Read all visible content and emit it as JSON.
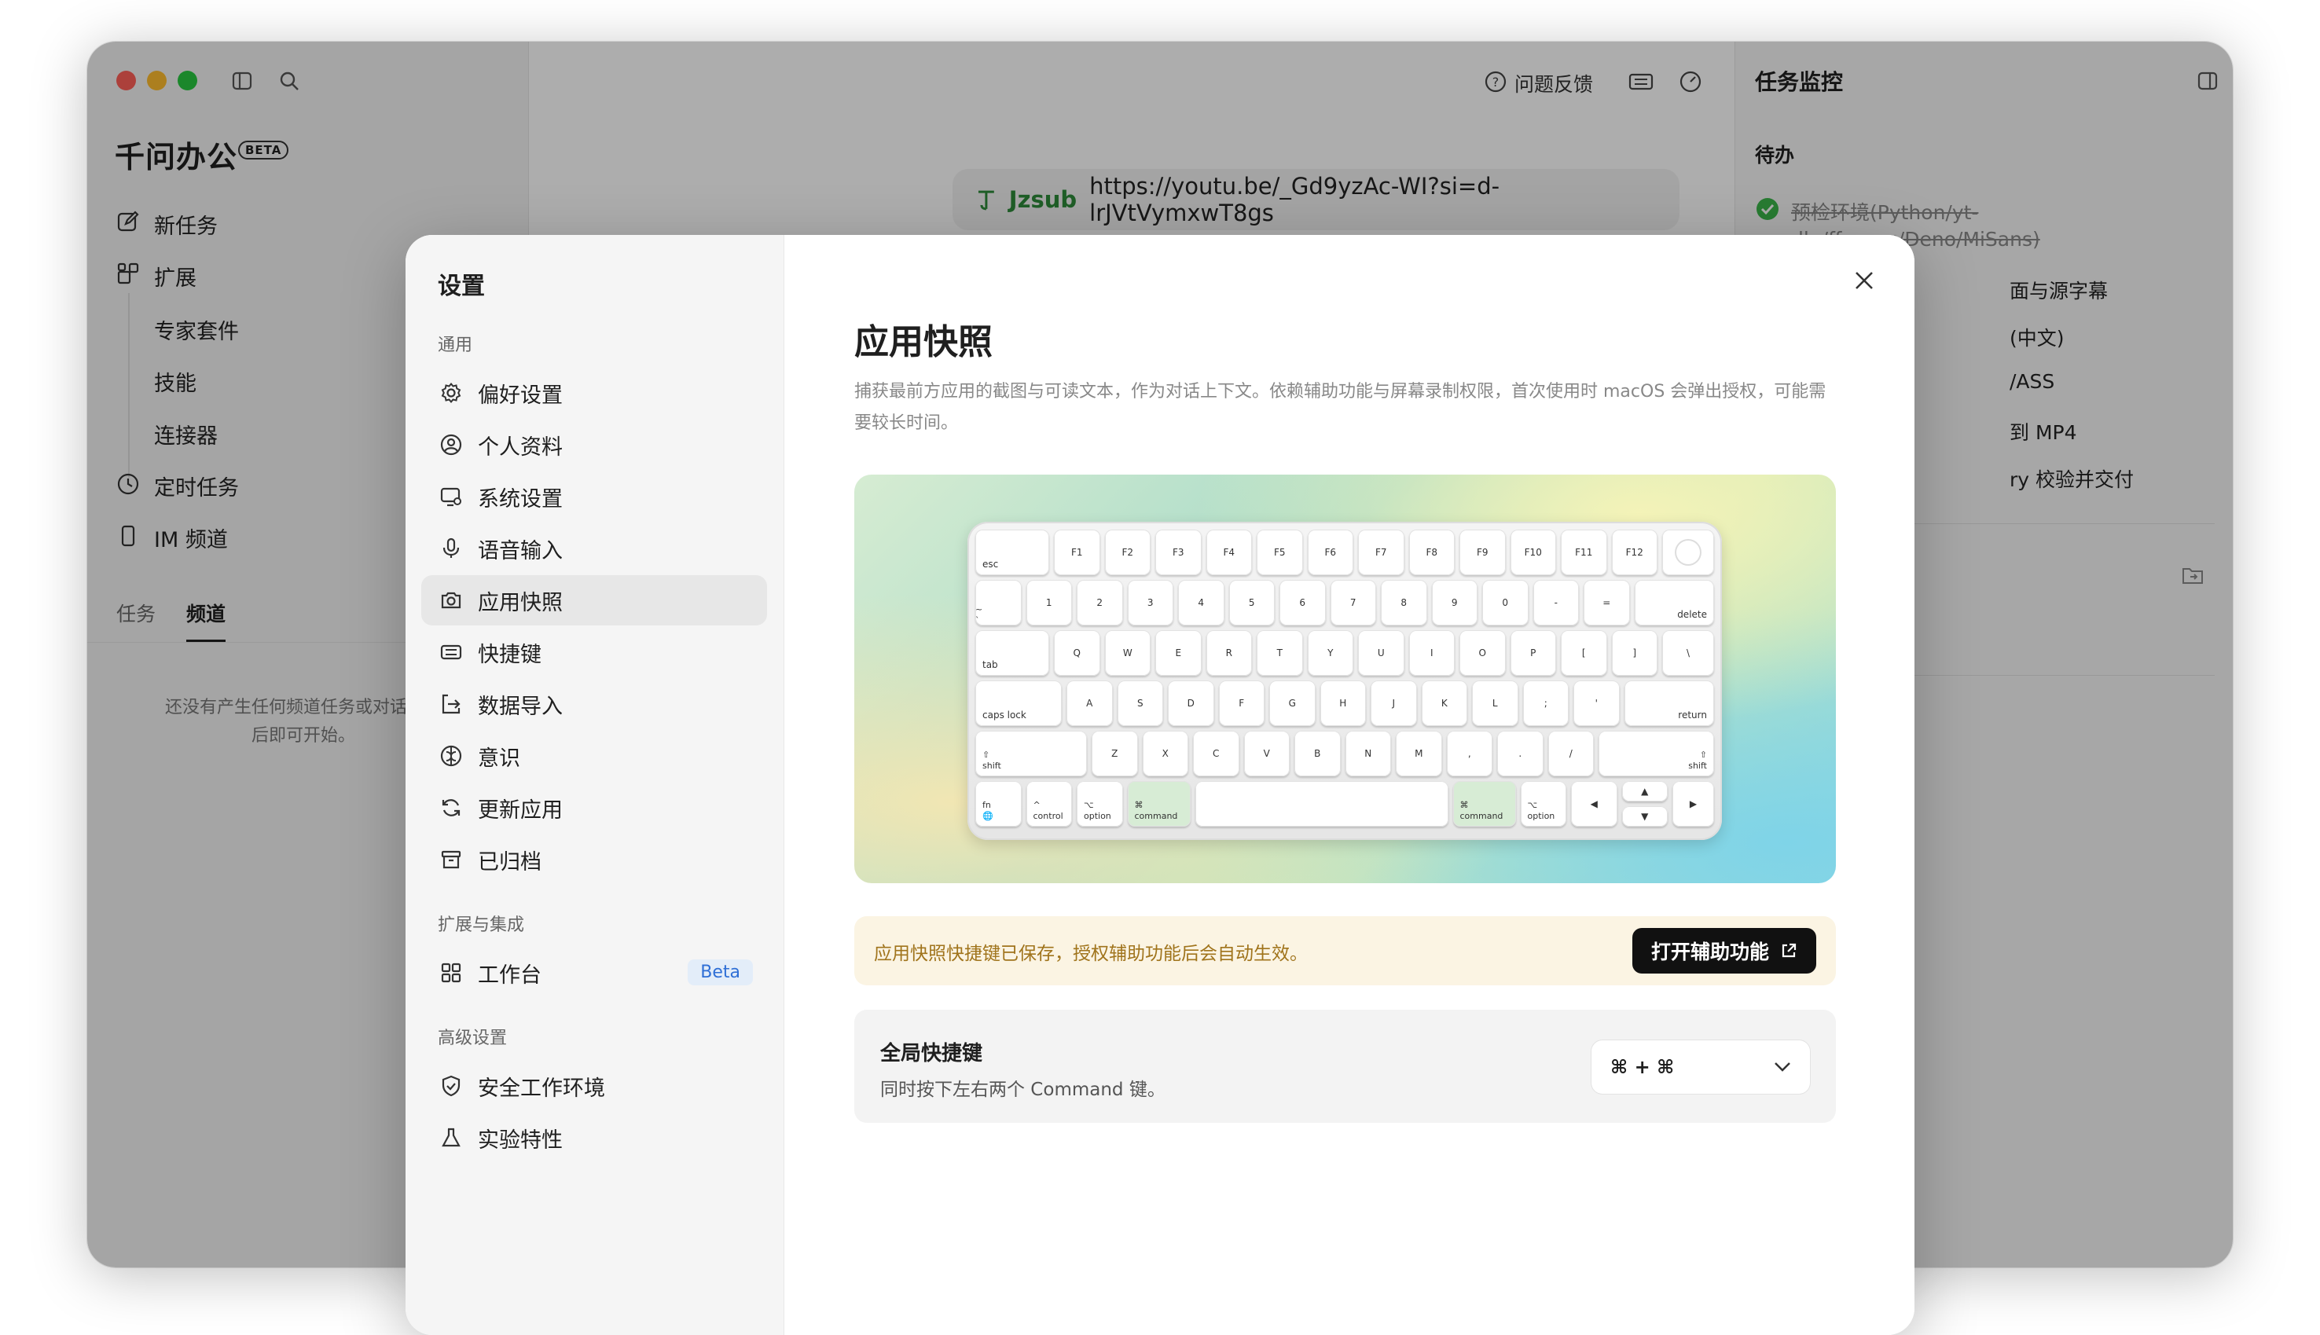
{
  "app": {
    "name": "千问办公",
    "beta": "BETA",
    "nav": {
      "new_task": "新任务",
      "extensions": "扩展",
      "sub": [
        "专家套件",
        "技能",
        "连接器"
      ],
      "scheduled": "定时任务",
      "im_channel": "IM 频道"
    },
    "tabs": [
      "任务",
      "频道"
    ],
    "empty_text": "还没有产生任何频道任务或对话，连\n后即可开始。"
  },
  "toolbar": {
    "feedback": "问题反馈"
  },
  "url_pill": {
    "app": "Jzsub",
    "url": "https://youtu.be/_Gd9yzAc-WI?si=d-lrJVtVymxwT8gs"
  },
  "right_panel": {
    "title": "任务监控",
    "section": "待办",
    "items": [
      "预检环境(Python/yt-",
      "dlp/ffmpeg/Deno/MiSans)",
      "面与源字幕",
      "(中文)",
      "/ASS",
      "到 MP4",
      "ry 校验并交付"
    ]
  },
  "settings": {
    "title": "设置",
    "sections": {
      "general": "通用",
      "ext": "扩展与集成",
      "advanced": "高级设置"
    },
    "items": {
      "prefs": "偏好设置",
      "profile": "个人资料",
      "system": "系统设置",
      "voice": "语音输入",
      "snapshot": "应用快照",
      "shortcuts": "快捷键",
      "import": "数据导入",
      "awareness": "意识",
      "update": "更新应用",
      "archived": "已归档",
      "workbench": "工作台",
      "workbench_badge": "Beta",
      "secure_env": "安全工作环境",
      "experimental": "实验特性"
    },
    "page": {
      "title": "应用快照",
      "description": "捕获最前方应用的截图与可读文本，作为对话上下文。依赖辅助功能与屏幕录制权限，首次使用时 macOS 会弹出授权，可能需要较长时间。",
      "notice": "应用快照快捷键已保存，授权辅助功能后会自动生效。",
      "notice_button": "打开辅助功能",
      "shortcut_title": "全局快捷键",
      "shortcut_desc": "同时按下左右两个 Command 键。",
      "shortcut_value": "⌘ + ⌘"
    }
  },
  "keyboard": {
    "row0": [
      "esc",
      "F1",
      "F2",
      "F3",
      "F4",
      "F5",
      "F6",
      "F7",
      "F8",
      "F9",
      "F10",
      "F11",
      "F12"
    ],
    "row1": [
      "~\n`",
      "1",
      "2",
      "3",
      "4",
      "5",
      "6",
      "7",
      "8",
      "9",
      "0",
      "-",
      "=",
      "delete"
    ],
    "row2": [
      "tab",
      "Q",
      "W",
      "E",
      "R",
      "T",
      "Y",
      "U",
      "I",
      "O",
      "P",
      "[",
      "]",
      "\\"
    ],
    "row3": [
      "caps lock",
      "A",
      "S",
      "D",
      "F",
      "G",
      "H",
      "J",
      "K",
      "L",
      ";",
      "'",
      "return"
    ],
    "row4": [
      "⇧\nshift",
      "Z",
      "X",
      "C",
      "V",
      "B",
      "N",
      "M",
      ",",
      ".",
      "/",
      "⇧\nshift"
    ],
    "row5": [
      "fn\n🌐",
      "^\ncontrol",
      "⌥\noption",
      "⌘\ncommand",
      "",
      "⌘\ncommand",
      "⌥\noption",
      "◀",
      "▲",
      "▼",
      "▶"
    ]
  },
  "colors": {
    "accent_green": "#2e8b3a",
    "notice_bg": "#fbf4e3",
    "notice_text": "#a0741c",
    "beta_blue": "#2f6fd6"
  }
}
